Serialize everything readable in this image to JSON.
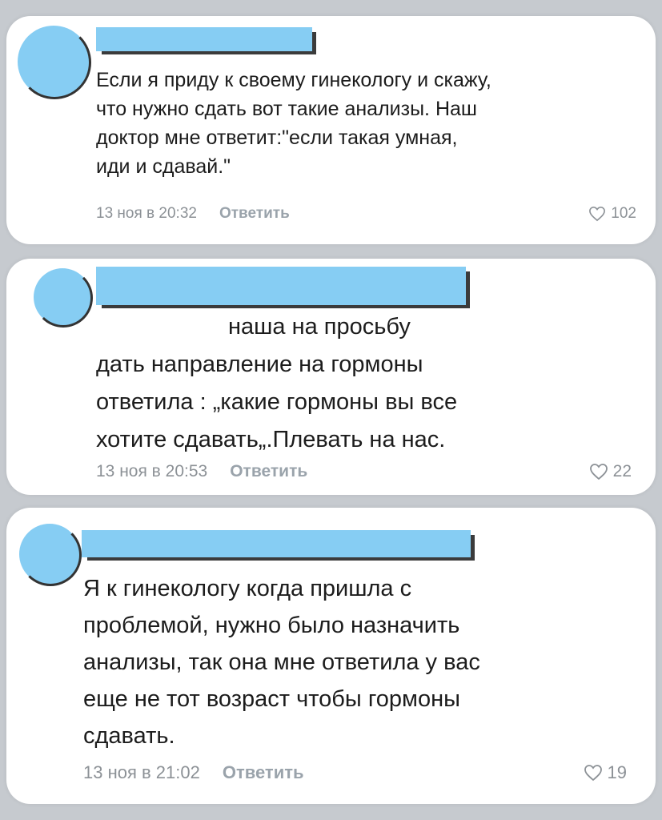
{
  "comments": [
    {
      "text": "Если я приду к своему гинекологу и скажу,\nчто нужно сдать вот такие анализы. Наш\nдоктор мне ответит:\"если такая умная,\nиди и сдавай.\"",
      "date": "13 ноя в 20:32",
      "reply_label": "Ответить",
      "likes": "102"
    },
    {
      "text": "наша на просьбу\nдать направление на гормоны\nответила : „какие гормоны вы все\nхотите сдавать„.Плевать на нас.",
      "date": "13 ноя в 20:53",
      "reply_label": "Ответить",
      "likes": "22"
    },
    {
      "text": "Я к гинекологу когда пришла с\nпроблемой, нужно было назначить\nанализы, так она мне ответила у вас\nеще не тот возраст чтобы гормоны\nсдавать.",
      "date": "13 ноя в 21:02",
      "reply_label": "Ответить",
      "likes": "19"
    }
  ],
  "colors": {
    "background": "#c6cacf",
    "card": "#ffffff",
    "avatar_placeholder": "#86cdf3",
    "meta_text": "#8c9196"
  },
  "icons": {
    "like": "heart-outline-icon"
  }
}
